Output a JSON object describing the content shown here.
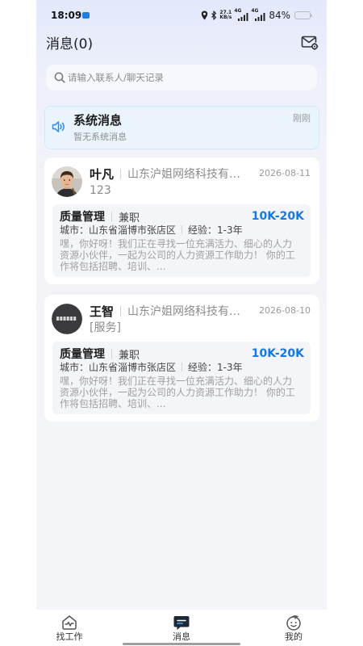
{
  "status_bar": {
    "time": "18:09",
    "net_speed": "27.1",
    "net_unit": "KB/s",
    "sim1_network": "4G",
    "sim2_network": "4G",
    "battery": "84%"
  },
  "header": {
    "title": "消息(0)",
    "action_icon": "mail-settings-icon"
  },
  "search": {
    "placeholder": "请输入联系人/聊天记录",
    "value": "",
    "icon": "search-icon"
  },
  "system_message": {
    "icon": "speaker-icon",
    "title": "系统消息",
    "preview": "暂无系统消息",
    "time": "刚刚"
  },
  "conversations": [
    {
      "name": "叶凡",
      "company": "山东沪姐网络科技有…",
      "date": "2026-08-11",
      "last_message": "123",
      "job": {
        "title": "质量管理",
        "type": "兼职",
        "salary": "10K-20K",
        "city": "城市：山东省淄博市张店区",
        "experience": "经验：1-3年",
        "description": "嘿，你好呀！我们正在寻找一位充满活力、细心的人力资源小伙伴，一起为公司的人力资源工作助力！ 你的工作将包括招聘、培训、..."
      }
    },
    {
      "name": "王智",
      "company": "山东沪姐网络科技有…",
      "date": "2026-08-10",
      "last_message": "[服务]",
      "job": {
        "title": "质量管理",
        "type": "兼职",
        "salary": "10K-20K",
        "city": "城市：山东省淄博市张店区",
        "experience": "经验：1-3年",
        "description": "嘿，你好呀！我们正在寻找一位充满活力、细心的人力资源小伙伴，一起为公司的人力资源工作助力！ 你的工作将包括招聘、培训、..."
      }
    }
  ],
  "tab_bar": {
    "items": [
      {
        "label": "找工作",
        "icon": "find-jobs-icon",
        "active": false
      },
      {
        "label": "消息",
        "icon": "messages-icon",
        "active": true
      },
      {
        "label": "我的",
        "icon": "profile-icon",
        "active": false
      }
    ]
  },
  "colors": {
    "salary": "#1677e6",
    "system_card_bg": "#eaf4fd",
    "speaker_icon": "#2a8cf0",
    "active_tab_icon": "#1e2836"
  }
}
